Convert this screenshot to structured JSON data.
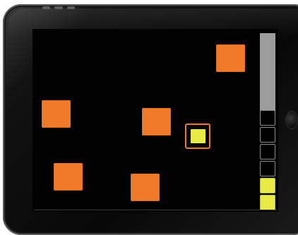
{
  "game": {
    "tile_color": "#f07a2a",
    "active_color": "#e8ea45",
    "tiles": [
      {
        "id": 1
      },
      {
        "id": 2
      },
      {
        "id": 3
      },
      {
        "id": 4
      },
      {
        "id": 5
      },
      {
        "id": 6
      }
    ],
    "selector": {
      "id": "active-tile"
    },
    "meter": {
      "total_slots": 6,
      "filled_slots": 2
    }
  }
}
